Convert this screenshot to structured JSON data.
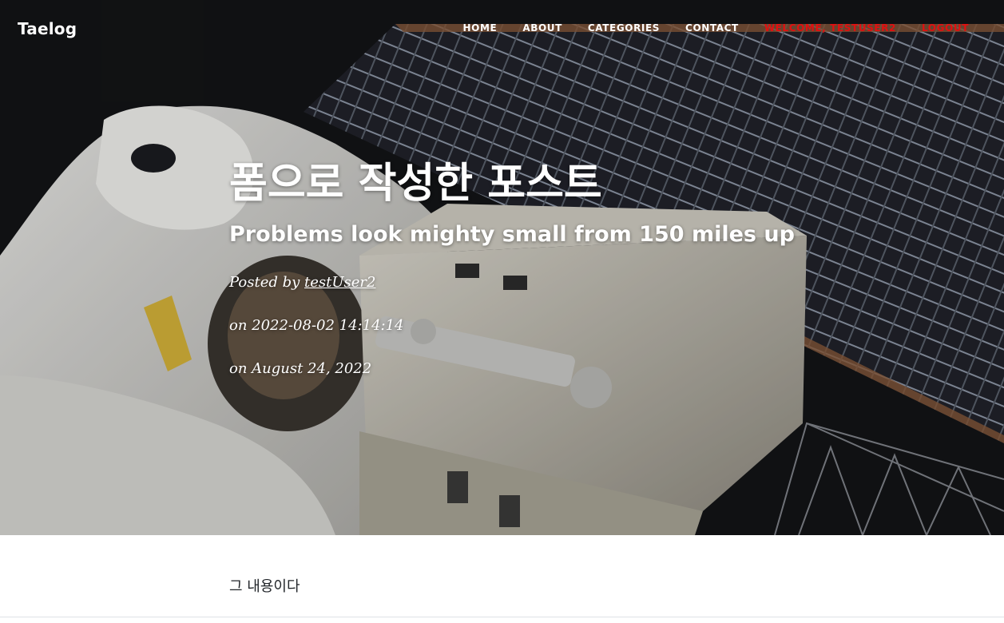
{
  "site": {
    "brand": "Taelog"
  },
  "nav": {
    "items": [
      {
        "label": "HOME"
      },
      {
        "label": "ABOUT"
      },
      {
        "label": "CATEGORIES"
      },
      {
        "label": "CONTACT"
      },
      {
        "label": "WELCOME, TESTUSER2"
      },
      {
        "label": "LOGOUT"
      }
    ]
  },
  "post": {
    "title": "폼으로 작성한 포스트",
    "subtitle": "Problems look mighty small from 150 miles up",
    "posted_by_prefix": "Posted by",
    "author": "testUser2",
    "created_line": "on 2022-08-02 14:14:14",
    "date_line": "on August 24, 2022",
    "body": "그 내용이다"
  },
  "colors": {
    "nav_text": "#ffffff",
    "nav_highlight": "#e01010",
    "body_text": "#212529"
  }
}
